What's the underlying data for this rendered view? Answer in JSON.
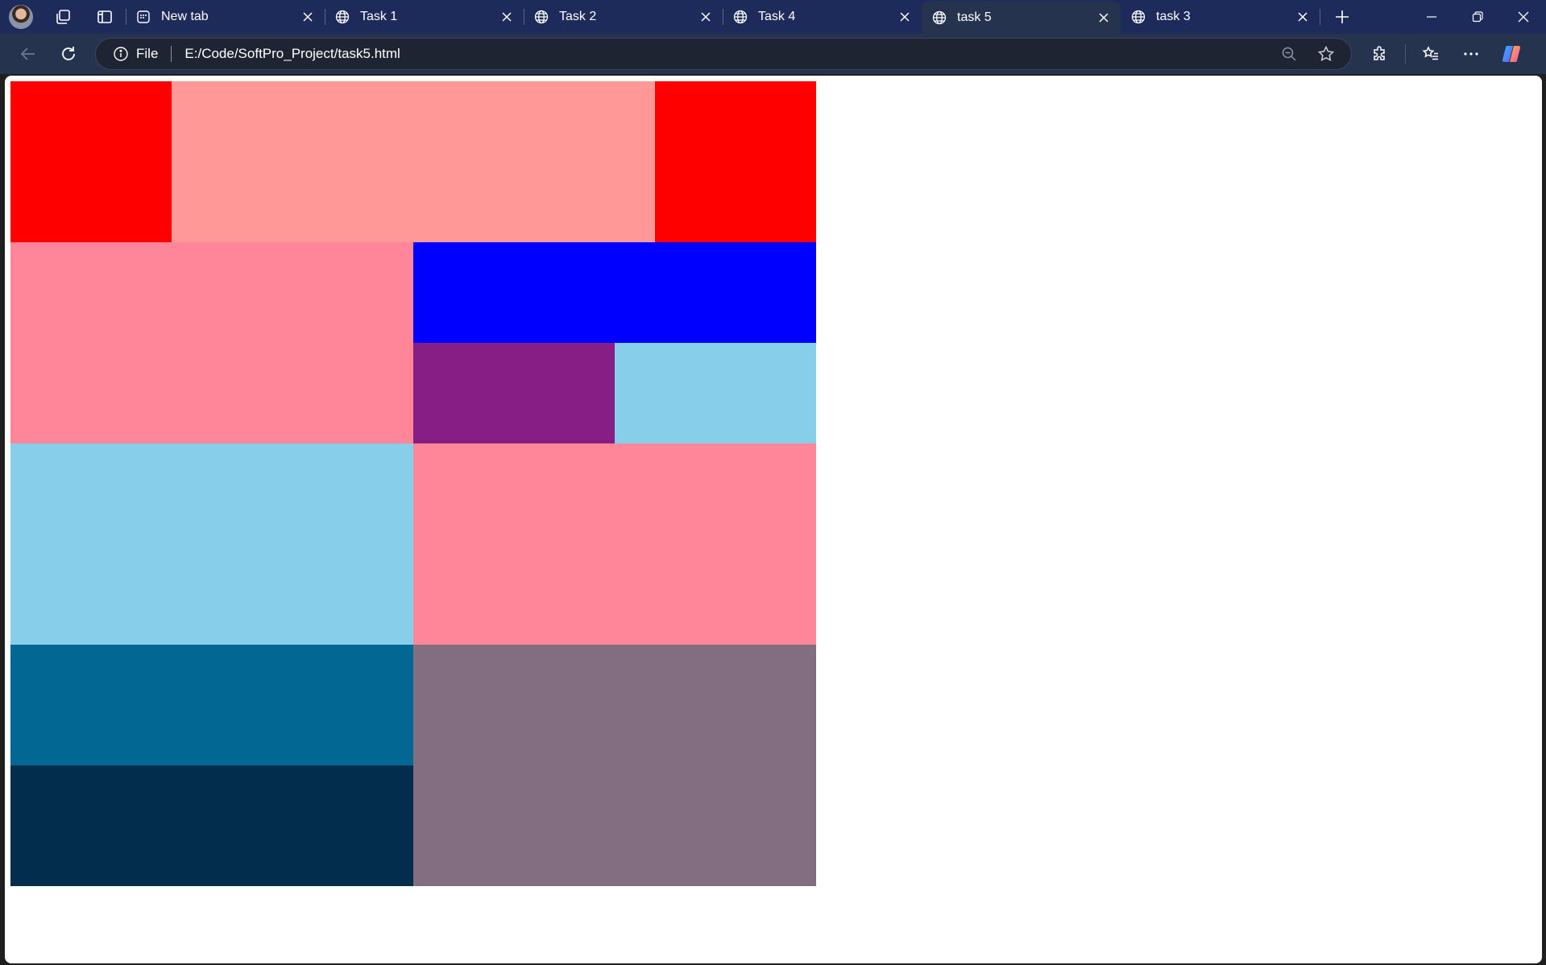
{
  "tabs": [
    {
      "title": "New tab",
      "icon": "new-tab-page-icon",
      "active": false
    },
    {
      "title": "Task 1",
      "icon": "globe-icon",
      "active": false
    },
    {
      "title": "Task 2",
      "icon": "globe-icon",
      "active": false
    },
    {
      "title": "Task 4",
      "icon": "globe-icon",
      "active": false
    },
    {
      "title": "task 5",
      "icon": "globe-icon",
      "active": true
    },
    {
      "title": "task 3",
      "icon": "globe-icon",
      "active": false
    }
  ],
  "address_bar": {
    "scheme_label": "File",
    "url": "E:/Code/SoftPro_Project/task5.html"
  },
  "page": {
    "background": "#ffffff",
    "blocks": [
      {
        "name": "block-red-top-left",
        "color": "#ff0000"
      },
      {
        "name": "block-salmon-top-center",
        "color": "#ff9896"
      },
      {
        "name": "block-red-top-right",
        "color": "#ff0000"
      },
      {
        "name": "block-pink-mid-left",
        "color": "#ff8598"
      },
      {
        "name": "block-blue-mid-right",
        "color": "#0000ff"
      },
      {
        "name": "block-purple",
        "color": "#861e85"
      },
      {
        "name": "block-skyblue-small",
        "color": "#87ceeb"
      },
      {
        "name": "block-skyblue-large",
        "color": "#87ceeb"
      },
      {
        "name": "block-pink-right",
        "color": "#ff8598"
      },
      {
        "name": "block-teal",
        "color": "#026893"
      },
      {
        "name": "block-navy",
        "color": "#022d4d"
      },
      {
        "name": "block-mauve",
        "color": "#826d81"
      }
    ]
  },
  "theme": {
    "tabstrip_bg": "#1c2b5a",
    "toolbar_bg": "#26334f"
  }
}
